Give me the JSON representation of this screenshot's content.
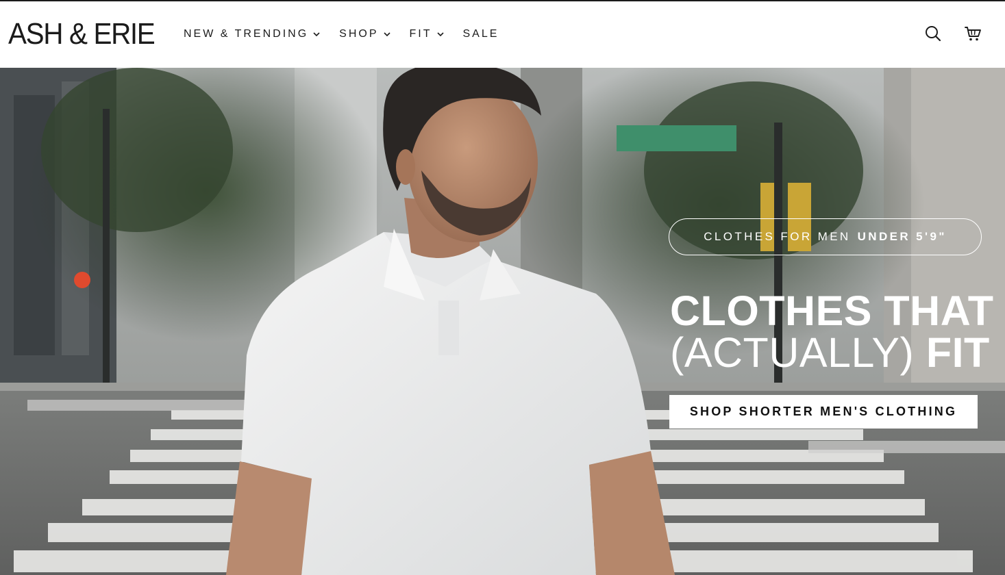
{
  "brand": {
    "logo_text": "ASH & ERIE"
  },
  "nav": {
    "items": [
      {
        "label": "NEW & TRENDING",
        "has_dropdown": true
      },
      {
        "label": "SHOP",
        "has_dropdown": true
      },
      {
        "label": "FIT",
        "has_dropdown": true
      },
      {
        "label": "SALE",
        "has_dropdown": false
      }
    ]
  },
  "header_icons": [
    "search-icon",
    "cart-icon"
  ],
  "hero": {
    "eyebrow_prefix": "CLOTHES FOR MEN",
    "eyebrow_emphasis": "UNDER 5'9\"",
    "headline_line1": "CLOTHES THAT",
    "headline_paren": "(ACTUALLY)",
    "headline_fit": "FIT",
    "cta_label": "SHOP SHORTER MEN'S CLOTHING"
  },
  "colors": {
    "text": "#1b1b1b",
    "header_bg": "#ffffff",
    "hero_text": "#ffffff",
    "cta_bg": "#ffffff"
  }
}
